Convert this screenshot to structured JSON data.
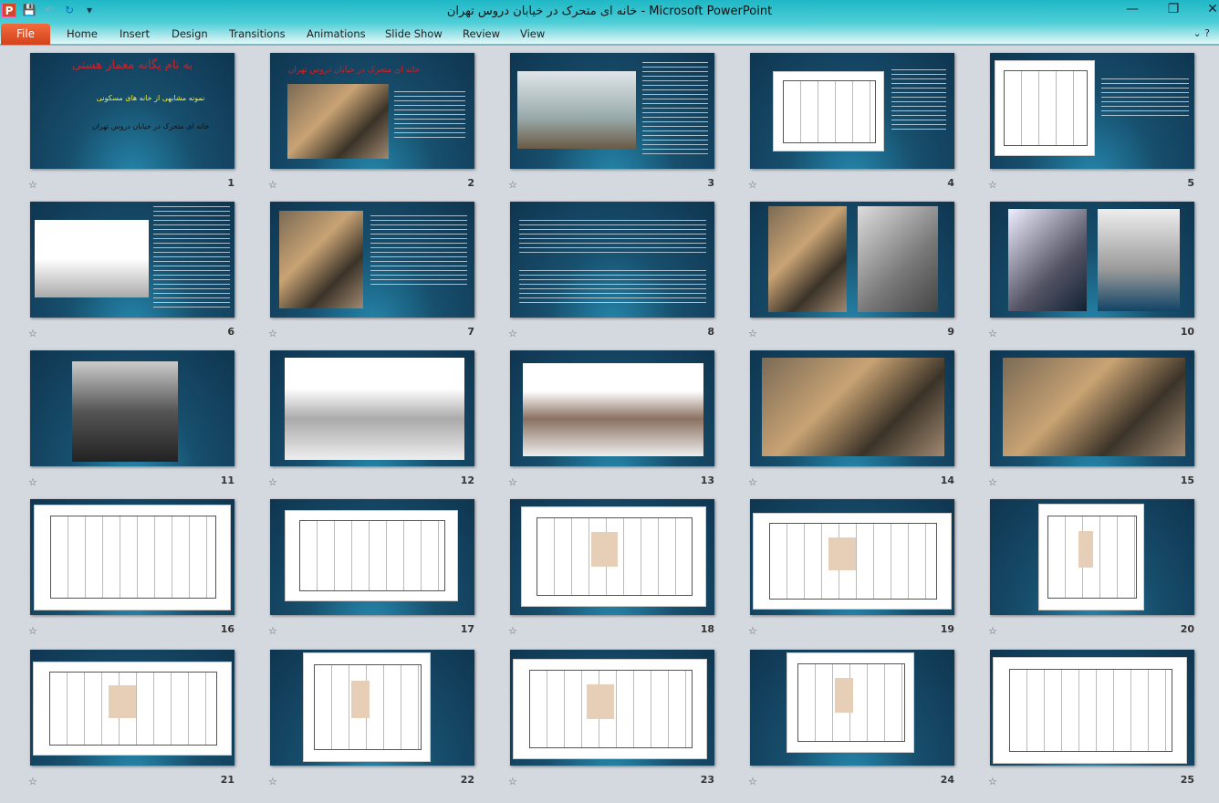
{
  "window": {
    "title": "خانه ای متحرک در خیابان دروس تهران  -  Microsoft PowerPoint",
    "minimize": "—",
    "restore": "❐",
    "close": "✕"
  },
  "qat": {
    "app_icon": "P",
    "save_icon": "save-icon",
    "undo_icon": "undo-icon",
    "redo_icon": "redo-icon",
    "customize_icon": "▾"
  },
  "ribbon": {
    "file": "File",
    "tabs": [
      "Home",
      "Insert",
      "Design",
      "Transitions",
      "Animations",
      "Slide Show",
      "Review",
      "View"
    ],
    "help": "⌄ ?"
  },
  "slides": {
    "s1": {
      "title": "به نام یگانه معمار هستی",
      "subtitle": "نمونه مشابهی از خانه های مسکونی",
      "text": "خانه ای متحرک در خیابان دروس تهران"
    },
    "s2": {
      "title": "خانه ای متحرک در خیابان دروس تهران"
    },
    "numbers": [
      "1",
      "2",
      "3",
      "4",
      "5",
      "6",
      "7",
      "8",
      "9",
      "10",
      "11",
      "12",
      "13",
      "14",
      "15",
      "16",
      "17",
      "18",
      "19",
      "20",
      "21",
      "22",
      "23",
      "24",
      "25"
    ],
    "transition_icon": "☆"
  },
  "colors": {
    "slide_title_red": "#d0202a",
    "slide_subtitle_yellow": "#f0f040"
  }
}
